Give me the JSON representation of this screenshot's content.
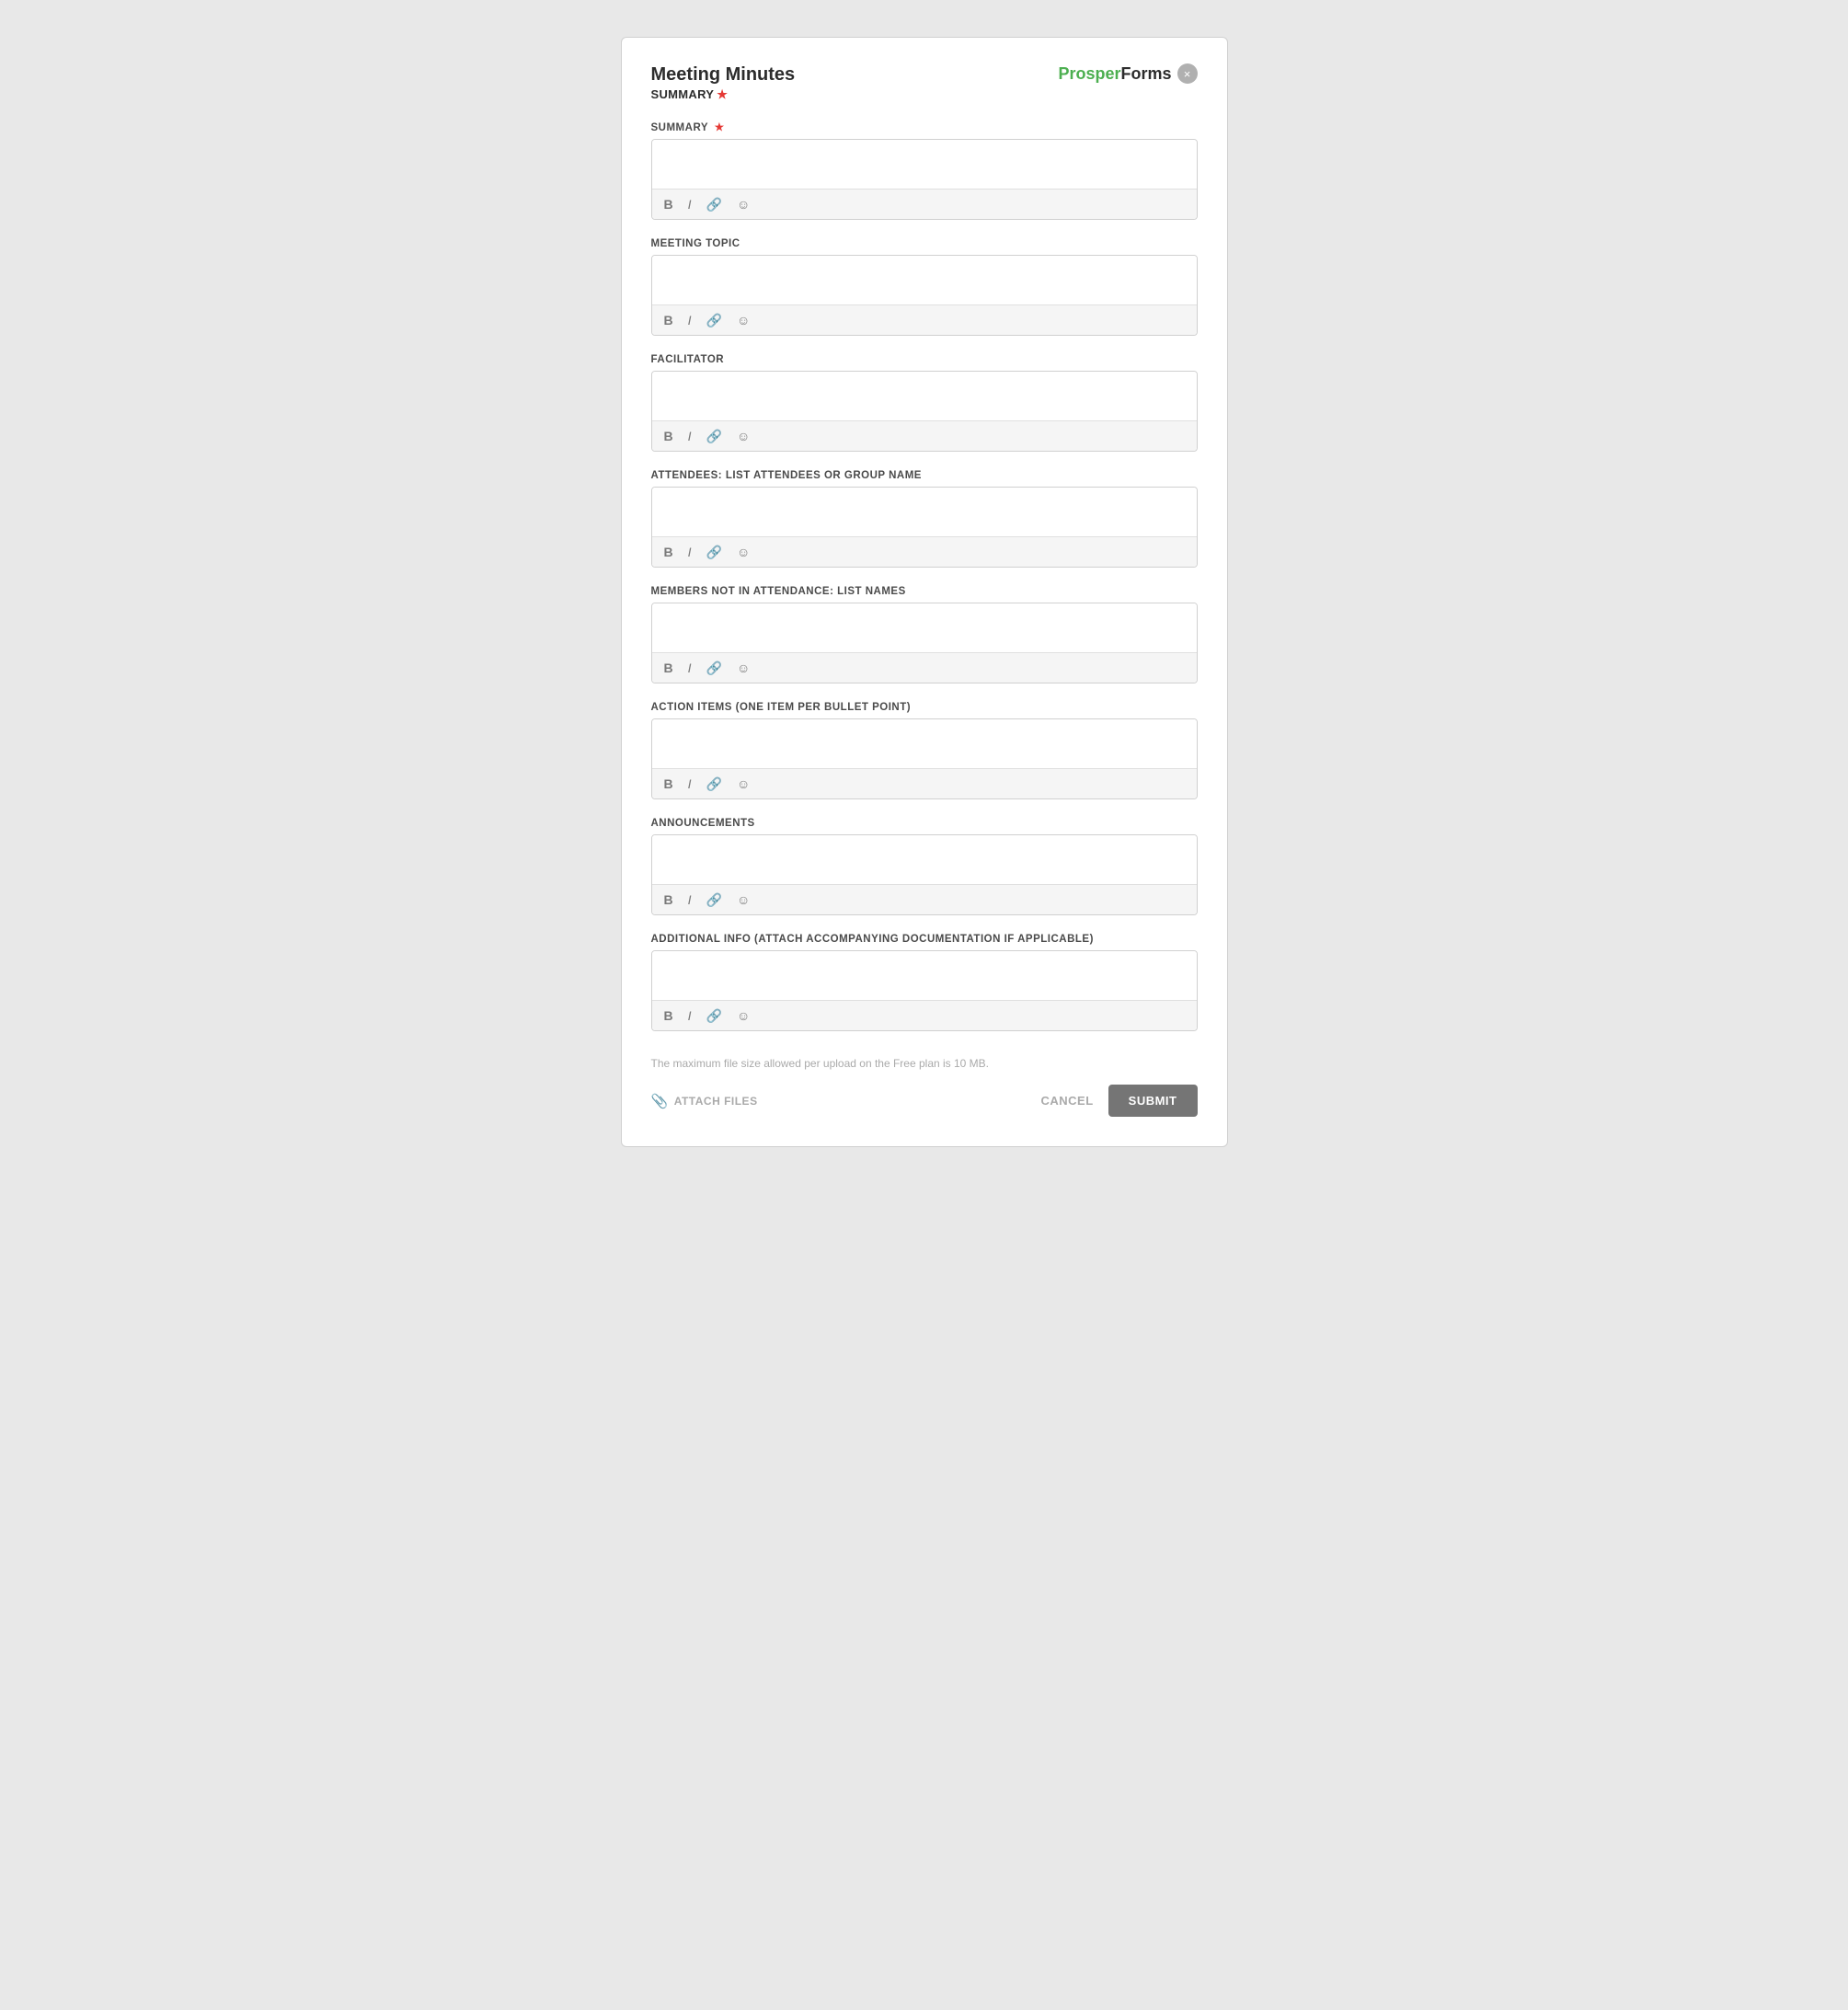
{
  "header": {
    "title": "Meeting Minutes",
    "subtitle": "SUMMARY",
    "required_indicator": "★",
    "logo_prosper": "Prosper",
    "logo_forms": "Forms",
    "close_label": "×"
  },
  "fields": [
    {
      "id": "summary",
      "label": "SUMMARY",
      "required": true,
      "toolbar": [
        "B",
        "I",
        "🔗",
        "☺"
      ]
    },
    {
      "id": "meeting_topic",
      "label": "MEETING TOPIC",
      "required": false,
      "toolbar": [
        "B",
        "I",
        "🔗",
        "☺"
      ]
    },
    {
      "id": "facilitator",
      "label": "FACILITATOR",
      "required": false,
      "toolbar": [
        "B",
        "I",
        "🔗",
        "☺"
      ]
    },
    {
      "id": "attendees",
      "label": "ATTENDEES: LIST ATTENDEES OR GROUP NAME",
      "required": false,
      "toolbar": [
        "B",
        "I",
        "🔗",
        "☺"
      ]
    },
    {
      "id": "members_not_in_attendance",
      "label": "MEMBERS NOT IN ATTENDANCE: LIST NAMES",
      "required": false,
      "toolbar": [
        "B",
        "I",
        "🔗",
        "☺"
      ]
    },
    {
      "id": "action_items",
      "label": "ACTION ITEMS (ONE ITEM PER BULLET POINT)",
      "required": false,
      "toolbar": [
        "B",
        "I",
        "🔗",
        "☺"
      ]
    },
    {
      "id": "announcements",
      "label": "ANNOUNCEMENTS",
      "required": false,
      "toolbar": [
        "B",
        "I",
        "🔗",
        "☺"
      ]
    },
    {
      "id": "additional_info",
      "label": "ADDITIONAL INFO (ATTACH ACCOMPANYING DOCUMENTATION IF APPLICABLE)",
      "required": false,
      "toolbar": [
        "B",
        "I",
        "🔗",
        "☺"
      ]
    }
  ],
  "footer": {
    "file_size_note": "The maximum file size allowed per upload on the Free plan is 10 MB.",
    "attach_label": "ATTACH FILES",
    "cancel_label": "CANCEL",
    "submit_label": "SUBMIT"
  }
}
